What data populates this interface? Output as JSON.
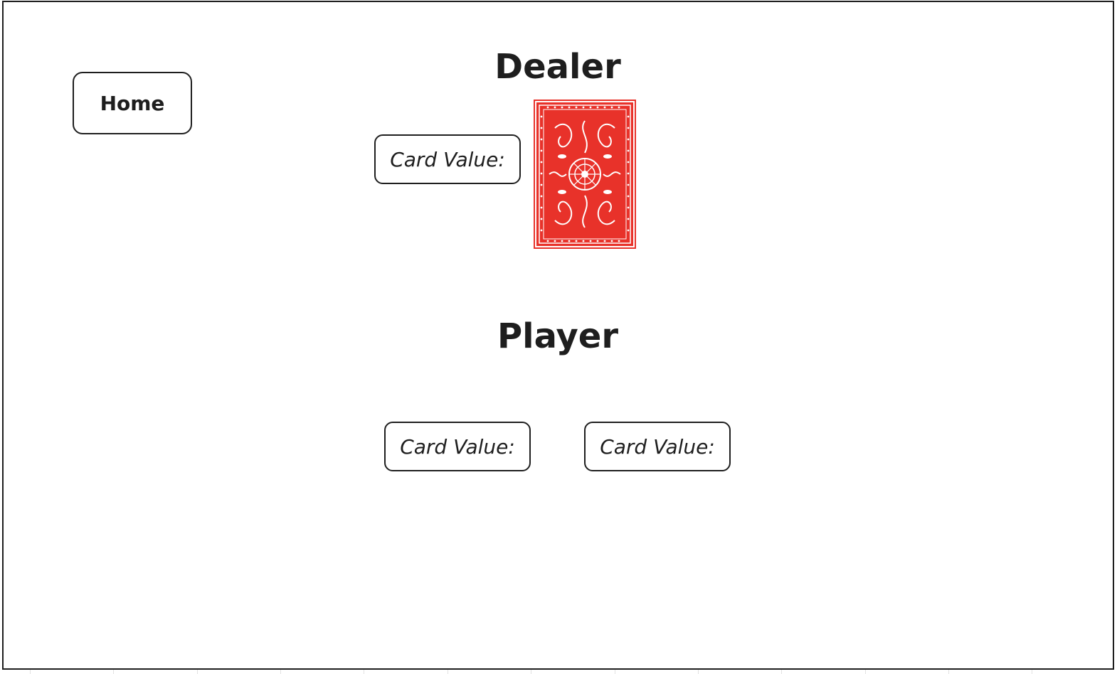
{
  "nav": {
    "home_label": "Home"
  },
  "dealer": {
    "heading": "Dealer",
    "card_value_label": "Card Value:",
    "card_face": "card-back"
  },
  "player": {
    "heading": "Player",
    "card_values": [
      "Card Value:",
      "Card Value:"
    ]
  },
  "colors": {
    "card_back_red": "#e8322a",
    "border": "#1e1e1e"
  }
}
